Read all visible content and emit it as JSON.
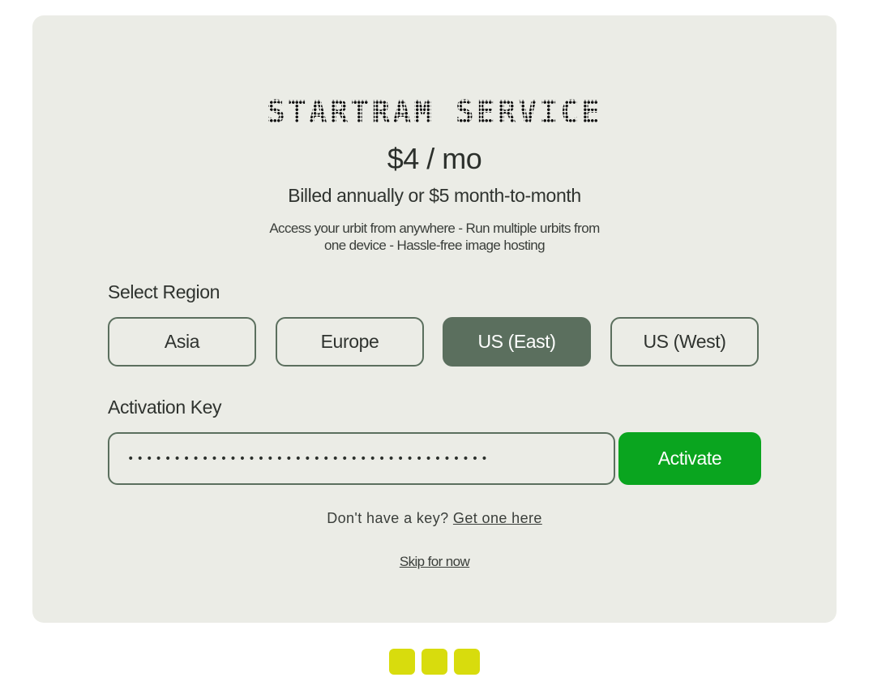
{
  "header": {
    "title": "STARTRAM SERVICE"
  },
  "pricing": {
    "price": "$4 / mo",
    "billing": "Billed annually or $5 month-to-month",
    "features_line1": "Access your urbit from anywhere - Run multiple urbits from",
    "features_line2": "one device - Hassle-free image hosting"
  },
  "region": {
    "label": "Select Region",
    "options": [
      "Asia",
      "Europe",
      "US (East)",
      "US (West)"
    ],
    "selected": "US (East)"
  },
  "activation": {
    "label": "Activation Key",
    "masked_value": "•••••••••••••••••••••••••••••••••••••••",
    "button_label": "Activate"
  },
  "help": {
    "prompt": "Don't have a key?",
    "link": "Get one here"
  },
  "skip_label": "Skip for now",
  "progress": {
    "steps": 3
  },
  "colors": {
    "card_bg": "#ebece6",
    "region_border": "#5b6f5e",
    "region_selected_bg": "#5b6f5e",
    "activate_bg": "#0aa51f",
    "step_dot": "#d8dc0d"
  }
}
